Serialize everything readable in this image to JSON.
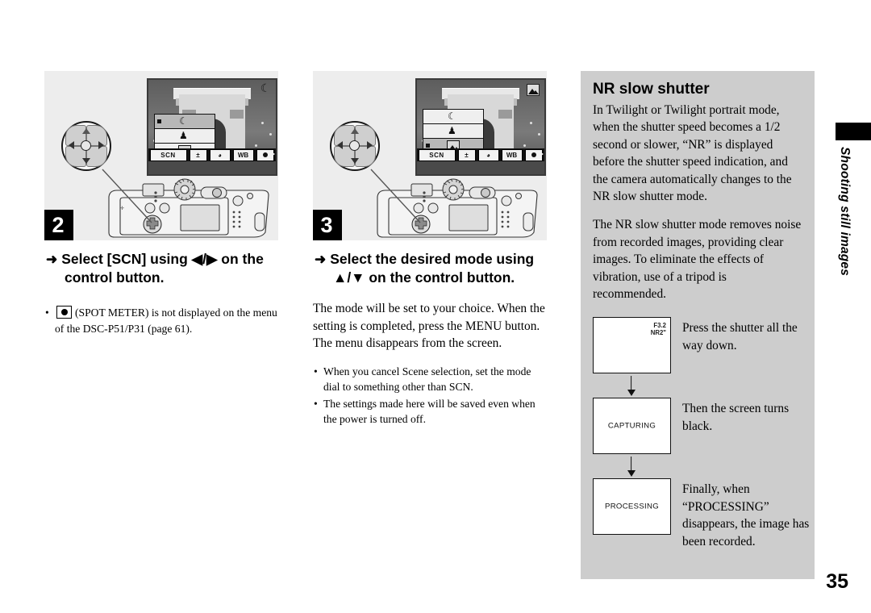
{
  "page": {
    "number": "35",
    "side_tab_label": "Shooting still images"
  },
  "steps": [
    {
      "badge": "2",
      "heading_line1": "Select [SCN] using ◀/▶ on the",
      "heading_line2": "control button.",
      "arrow_glyph": "➜",
      "lcd": {
        "mode_icon": "moon-icon",
        "mode_glyph": "☾",
        "menu_items": [
          "SCN",
          "EV",
          "PFX",
          "WB",
          "SPOT"
        ],
        "menu_selected": "SCN",
        "scene_rows": [
          {
            "icon": "twilight-moon-icon",
            "glyph": "☾",
            "selected": true
          },
          {
            "icon": "twilight-portrait-icon",
            "glyph": "♟",
            "selected": false
          },
          {
            "icon": "landscape-icon",
            "glyph": "",
            "selected": false
          }
        ]
      },
      "notes": [
        {
          "icon": "spot-meter-icon",
          "text_before": "",
          "text_after": "(SPOT METER) is not displayed on the menu of the DSC-P51/P31 (page 61)."
        }
      ]
    },
    {
      "badge": "3",
      "heading_line1": "Select the desired mode using",
      "heading_line2": "▲/▼ on the control button.",
      "arrow_glyph": "➜",
      "lcd": {
        "mode_icon": "landscape-icon",
        "mode_glyph": "",
        "menu_items": [
          "SCN",
          "EV",
          "PFX",
          "WB",
          "SPOT"
        ],
        "menu_selected": "SCN",
        "scene_rows": [
          {
            "icon": "twilight-moon-icon",
            "glyph": "☾",
            "selected": false
          },
          {
            "icon": "twilight-portrait-icon",
            "glyph": "♟",
            "selected": false
          },
          {
            "icon": "landscape-icon",
            "glyph": "",
            "selected": true
          }
        ]
      },
      "body": "The mode will be set to your choice. When the setting is completed, press the MENU button. The menu disappears from the screen.",
      "notes": [
        "When you cancel Scene selection, set the mode dial to something other than SCN.",
        "The settings made here will be saved even when the power is turned off."
      ]
    }
  ],
  "sidebar": {
    "title": "NR slow shutter",
    "paragraphs": [
      "In Twilight or Twilight portrait mode, when the shutter speed becomes a 1/2 second or slower, “NR” is displayed before the shutter speed indication, and the camera automatically changes to the NR slow shutter mode.",
      "The NR slow shutter mode removes noise from recorded images, providing clear images. To eliminate the effects of vibration, use of a tripod is recommended."
    ],
    "flow": [
      {
        "box_label": "",
        "osd_line1": "F3.2",
        "osd_line2": "NR2\"",
        "caption": "Press the shutter all the way down."
      },
      {
        "box_label": "CAPTURING",
        "osd_line1": "",
        "osd_line2": "",
        "caption": "Then the screen turns black."
      },
      {
        "box_label": "PROCESSING",
        "osd_line1": "",
        "osd_line2": "",
        "caption": "Finally, when “PROCESSING” disappears, the image has been recorded."
      }
    ]
  },
  "colors": {
    "illustration_panel_bg": "#ededed",
    "sidebar_bg": "#cdcdcd",
    "badge_bg": "#000000",
    "page_bg": "#ffffff"
  }
}
